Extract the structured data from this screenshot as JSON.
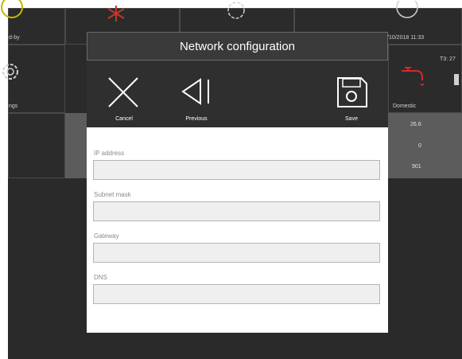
{
  "background": {
    "tiles": {
      "standby_label": "d-by",
      "datetime": "/10/2018 11:33",
      "settings_label": "ngs",
      "domestic_label": "Domestic",
      "t3_label": "T3: 27"
    },
    "values": [
      "26.6",
      "0",
      "901"
    ]
  },
  "dialog": {
    "title": "Network configuration",
    "toolbar": {
      "cancel_label": "Cancel",
      "previous_label": "Previous",
      "save_label": "Save"
    },
    "fields": {
      "ip_label": "IP address",
      "ip_value": "",
      "subnet_label": "Subnet mask",
      "subnet_value": "",
      "gateway_label": "Gateway",
      "gateway_value": "",
      "dns_label": "DNS",
      "dns_value": ""
    }
  },
  "icons": [
    "standby-icon",
    "snowflake-icon",
    "gear-icon",
    "clock-icon",
    "settings-gear-icon",
    "faucet-icon",
    "close-icon",
    "previous-icon",
    "save-icon"
  ],
  "colors": {
    "background_panel": "#2a2a2a",
    "dialog_titlebar": "#3a3a3a",
    "toolbar": "#2f2f2f",
    "snowflake_red": "#c0392b",
    "faucet_red": "#d42a2a",
    "standby_yellow": "#c8b400"
  }
}
